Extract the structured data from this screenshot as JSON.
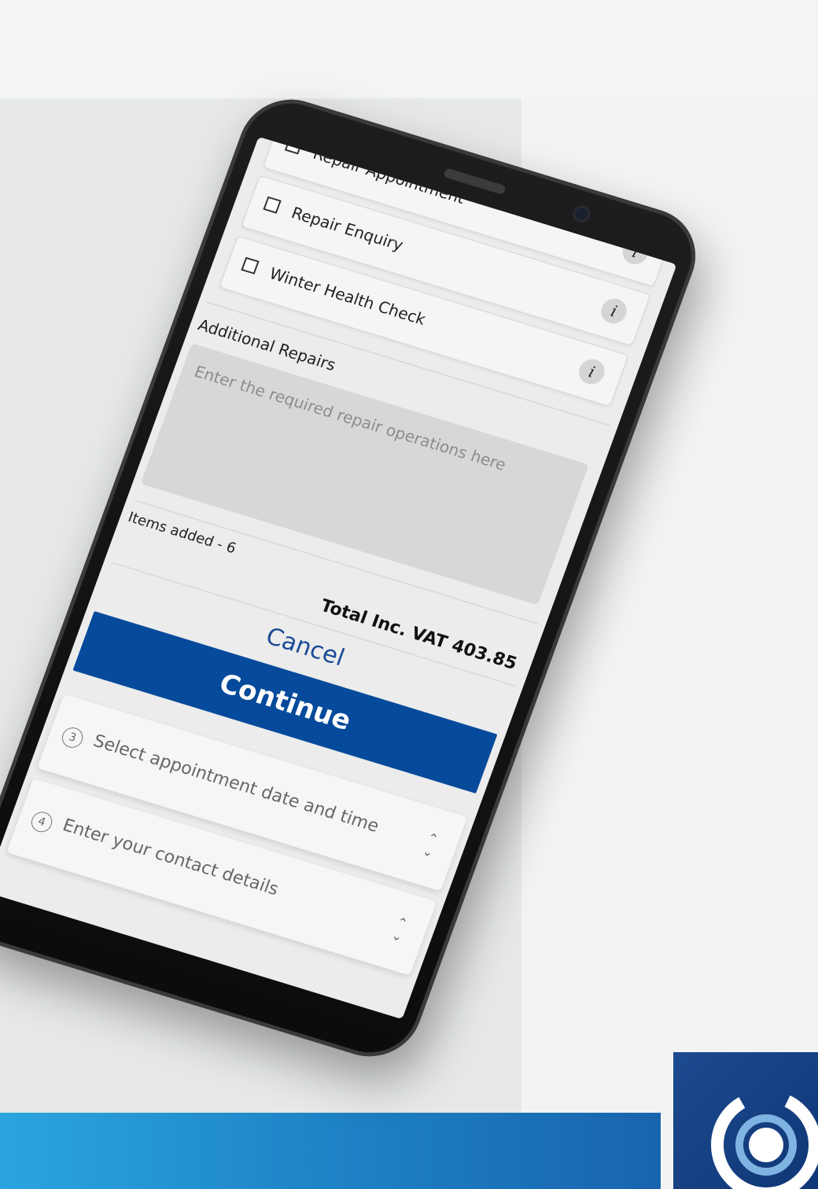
{
  "services": [
    {
      "label": "Repair Appointment"
    },
    {
      "label": "Repair Enquiry"
    },
    {
      "label": "Winter Health Check"
    }
  ],
  "info_glyph": "i",
  "additional_repairs": {
    "label": "Additional Repairs",
    "placeholder": "Enter the required repair operations here"
  },
  "summary": {
    "items_added": "Items added - 6",
    "total": "Total Inc. VAT 403.85"
  },
  "actions": {
    "cancel_label": "Cancel",
    "continue_label": "Continue"
  },
  "steps": [
    {
      "number": "3",
      "label": "Select appointment date and time",
      "icon": "chevron-up-down-icon"
    },
    {
      "number": "4",
      "label": "Enter your contact details",
      "icon": "chevron-up-down-icon"
    }
  ],
  "colors": {
    "primary": "#064a9b",
    "link": "#194a95",
    "banner_start": "#2aa5df",
    "banner_end": "#1864ad"
  }
}
